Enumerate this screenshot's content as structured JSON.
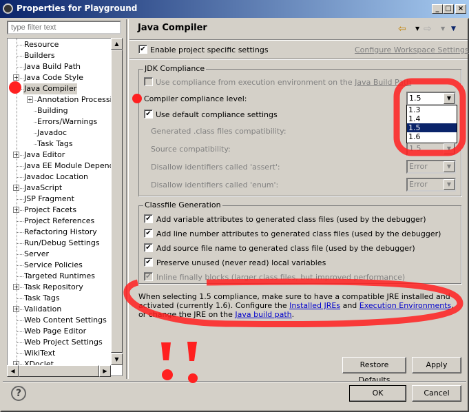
{
  "window": {
    "title": "Properties for Playground",
    "controls": [
      "_",
      "□",
      "×"
    ]
  },
  "filter": {
    "placeholder": "type filter text"
  },
  "tree": [
    {
      "label": "Resource",
      "level": 0,
      "expandable": false
    },
    {
      "label": "Builders",
      "level": 0,
      "expandable": false
    },
    {
      "label": "Java Build Path",
      "level": 0,
      "expandable": false
    },
    {
      "label": "Java Code Style",
      "level": 0,
      "expandable": true
    },
    {
      "label": "Java Compiler",
      "level": 0,
      "expandable": false,
      "selected": true
    },
    {
      "label": "Annotation Processing",
      "level": 1,
      "expandable": true
    },
    {
      "label": "Building",
      "level": 1,
      "expandable": false
    },
    {
      "label": "Errors/Warnings",
      "level": 1,
      "expandable": false
    },
    {
      "label": "Javadoc",
      "level": 1,
      "expandable": false
    },
    {
      "label": "Task Tags",
      "level": 1,
      "expandable": false
    },
    {
      "label": "Java Editor",
      "level": 0,
      "expandable": true
    },
    {
      "label": "Java EE Module Dependen",
      "level": 0,
      "expandable": false
    },
    {
      "label": "Javadoc Location",
      "level": 0,
      "expandable": false
    },
    {
      "label": "JavaScript",
      "level": 0,
      "expandable": true
    },
    {
      "label": "JSP Fragment",
      "level": 0,
      "expandable": false
    },
    {
      "label": "Project Facets",
      "level": 0,
      "expandable": true
    },
    {
      "label": "Project References",
      "level": 0,
      "expandable": false
    },
    {
      "label": "Refactoring History",
      "level": 0,
      "expandable": false
    },
    {
      "label": "Run/Debug Settings",
      "level": 0,
      "expandable": false
    },
    {
      "label": "Server",
      "level": 0,
      "expandable": false
    },
    {
      "label": "Service Policies",
      "level": 0,
      "expandable": false
    },
    {
      "label": "Targeted Runtimes",
      "level": 0,
      "expandable": false
    },
    {
      "label": "Task Repository",
      "level": 0,
      "expandable": true
    },
    {
      "label": "Task Tags",
      "level": 0,
      "expandable": false
    },
    {
      "label": "Validation",
      "level": 0,
      "expandable": true
    },
    {
      "label": "Web Content Settings",
      "level": 0,
      "expandable": false
    },
    {
      "label": "Web Page Editor",
      "level": 0,
      "expandable": false
    },
    {
      "label": "Web Project Settings",
      "level": 0,
      "expandable": false
    },
    {
      "label": "WikiText",
      "level": 0,
      "expandable": false
    },
    {
      "label": "XDoclet",
      "level": 0,
      "expandable": true
    }
  ],
  "page": {
    "title": "Java Compiler",
    "enable_project_settings": {
      "label": "Enable project specific settings",
      "checked": true
    },
    "configure_workspace_link": "Configure Workspace Settings...",
    "jdk": {
      "group_label": "JDK Compliance",
      "use_ee": {
        "label": "Use compliance from execution environment on the ",
        "link": "Java Build Path",
        "checked": false
      },
      "compliance_label": "Compiler compliance level:",
      "compliance_value": "1.5",
      "compliance_options": [
        "1.3",
        "1.4",
        "1.5",
        "1.6"
      ],
      "use_default": {
        "label": "Use default compliance settings",
        "checked": true
      },
      "generated_label": "Generated .class files compatibility:",
      "source_label": "Source compatibility:",
      "source_value": "1.5",
      "assert_label": "Disallow identifiers called 'assert':",
      "assert_value": "Error",
      "enum_label": "Disallow identifiers called 'enum':",
      "enum_value": "Error"
    },
    "classfile": {
      "group_label": "Classfile Generation",
      "options": [
        {
          "label": "Add variable attributes to generated class files (used by the debugger)",
          "checked": true,
          "enabled": true
        },
        {
          "label": "Add line number attributes to generated class files (used by the debugger)",
          "checked": true,
          "enabled": true
        },
        {
          "label": "Add source file name to generated class file (used by the debugger)",
          "checked": true,
          "enabled": true
        },
        {
          "label": "Preserve unused (never read) local variables",
          "checked": true,
          "enabled": true
        },
        {
          "label": "Inline finally blocks (larger class files, but improved performance)",
          "checked": true,
          "enabled": false
        }
      ]
    },
    "note": {
      "t1": "When selecting 1.5 compliance, make sure to have a compatible JRE installed and activated (currently 1.6). Configure the ",
      "l1": "Installed JREs",
      "t2": " and ",
      "l2": "Execution Environments",
      "t3": ", or change the JRE on the ",
      "l3": "Java build path",
      "t4": "."
    },
    "restore_defaults": "Restore Defaults",
    "apply": "Apply"
  },
  "footer": {
    "help": "?",
    "ok": "OK",
    "cancel": "Cancel"
  },
  "annotation": {
    "marks": "!!",
    "color": "#ff0000"
  }
}
